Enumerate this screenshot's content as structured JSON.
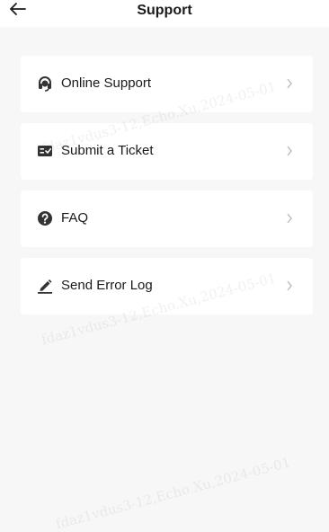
{
  "header": {
    "title": "Support",
    "back_icon": "arrow-left-icon"
  },
  "menu": {
    "items": [
      {
        "label": "Online Support",
        "icon": "headset-icon"
      },
      {
        "label": "Submit a Ticket",
        "icon": "ticket-icon"
      },
      {
        "label": "FAQ",
        "icon": "question-icon"
      },
      {
        "label": "Send Error Log",
        "icon": "edit-icon"
      }
    ]
  },
  "watermark": {
    "text": "fdaz1vdus3-12,Echo.Xu,2024-05-01"
  },
  "colors": {
    "background": "#f7f7f7",
    "card": "#ffffff",
    "text": "#1a1a1a",
    "icon": "#333333",
    "chevron": "#bbbbbb"
  }
}
